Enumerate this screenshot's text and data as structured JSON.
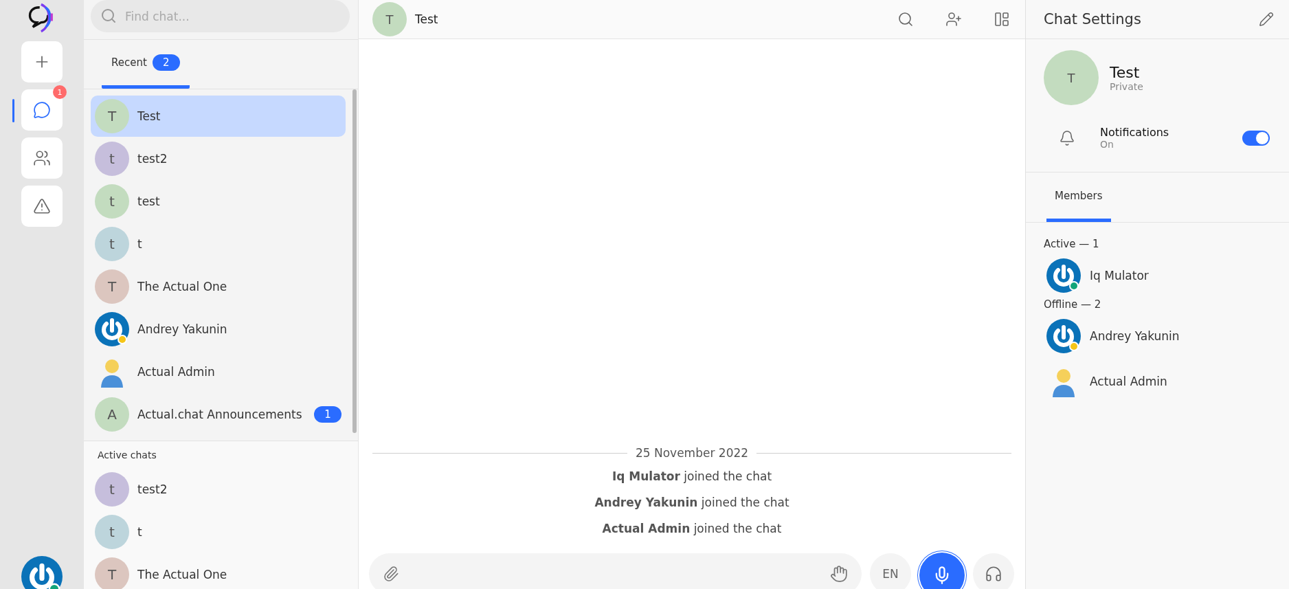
{
  "rail": {
    "items": [
      {
        "kind": "add",
        "selected": false
      },
      {
        "kind": "chats",
        "selected": true,
        "badge": "1"
      },
      {
        "kind": "contacts",
        "selected": false
      },
      {
        "kind": "alert",
        "selected": false
      }
    ],
    "account": {
      "color": "#12a57a"
    }
  },
  "search": {
    "placeholder": "Find chat..."
  },
  "list_tabs": [
    {
      "label": "Recent",
      "count": "2",
      "selected": true
    }
  ],
  "recent": [
    {
      "name": "Test",
      "kind": "letter",
      "initial": "T",
      "color": "#c3dcbf",
      "selected": true
    },
    {
      "name": "test2",
      "kind": "letter",
      "initial": "t",
      "color": "#c6bedc",
      "selected": false
    },
    {
      "name": "test",
      "kind": "letter",
      "initial": "t",
      "color": "#c3dcbf",
      "selected": false
    },
    {
      "name": "t",
      "kind": "letter",
      "initial": "t",
      "color": "#bdd5dc",
      "selected": false
    },
    {
      "name": "The Actual One",
      "kind": "letter",
      "initial": "T",
      "color": "#dcc6bf",
      "selected": false
    },
    {
      "name": "Andrey Yakunin",
      "kind": "logo",
      "color": "#f5c518",
      "selected": false
    },
    {
      "name": "Actual Admin",
      "kind": "figure",
      "selected": false
    },
    {
      "name": "Actual.chat Announcements",
      "kind": "letter",
      "initial": "A",
      "color": "#c3dcbf",
      "badge": "1",
      "selected": false
    }
  ],
  "active_chats": {
    "title": "Active chats",
    "items": [
      {
        "name": "test2",
        "kind": "letter",
        "initial": "t",
        "color": "#c6bedc",
        "selected": false
      },
      {
        "name": "t",
        "kind": "letter",
        "initial": "t",
        "color": "#bdd5dc",
        "selected": false
      },
      {
        "name": "The Actual One",
        "kind": "letter",
        "initial": "T",
        "color": "#dcc6bf",
        "selected": false
      }
    ]
  },
  "chat": {
    "title": "Test",
    "initial": "T",
    "color": "#c3dcbf",
    "date": "25 November 2022",
    "events": [
      "**Iq Mulator** joined the chat",
      "**Andrey Yakunin** joined the chat",
      "**Actual Admin** joined the chat"
    ],
    "composer": {
      "language": "EN",
      "recording": true
    }
  },
  "settings": {
    "title": "Chat Settings",
    "chat_name": "Test",
    "initial": "T",
    "color": "#c3dcbf",
    "visibility": "Private",
    "notifications": {
      "label": "Notifications",
      "status": "On",
      "on": true
    },
    "tabs": [
      {
        "label": "Members",
        "selected": true
      }
    ],
    "groups": [
      {
        "label": "Active — 1",
        "members": [
          {
            "name": "Iq Mulator",
            "kind": "logo",
            "color": "#12a57a"
          }
        ]
      },
      {
        "label": "Offline — 2",
        "members": [
          {
            "name": "Andrey Yakunin",
            "kind": "logo",
            "color": "#f5c518"
          },
          {
            "name": "Actual Admin",
            "kind": "figure"
          }
        ]
      }
    ]
  }
}
